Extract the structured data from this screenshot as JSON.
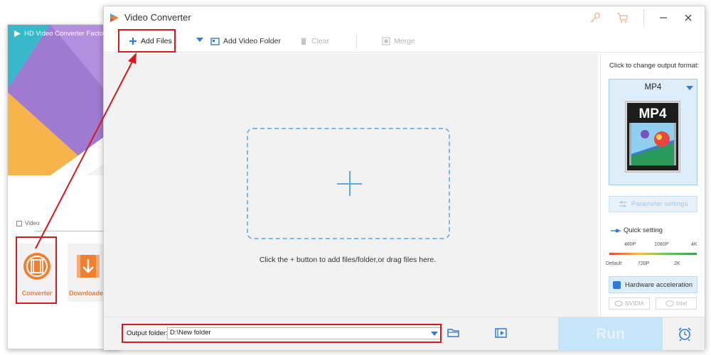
{
  "background_app": {
    "title": "HD Video Converter Factory",
    "section_label": "Video",
    "tiles": [
      {
        "label": "Converter",
        "icon": "film-icon"
      },
      {
        "label": "Downloader",
        "icon": "download-icon"
      }
    ]
  },
  "window": {
    "title": "Video Converter",
    "titlebar_icons": [
      "key-icon",
      "cart-icon",
      "minimize-icon",
      "close-icon"
    ]
  },
  "toolbar": {
    "add_files": "Add Files",
    "add_video_folder": "Add Video Folder",
    "clear": "Clear",
    "merge": "Merge"
  },
  "drop_area": {
    "hint": "Click the + button to add files/folder,or drag files here."
  },
  "side_panel": {
    "caption": "Click to change output format:",
    "format": "MP4",
    "format_thumb_text": "MP4",
    "parameter_settings": "Parameter settings",
    "quick_setting": "Quick setting",
    "quality_top": [
      "480P",
      "1080P",
      "4K"
    ],
    "quality_bottom": [
      "Default",
      "720P",
      "2K"
    ],
    "hardware_acceleration": "Hardware acceleration",
    "chips": [
      "NVIDIA",
      "Intel"
    ]
  },
  "bottombar": {
    "output_label": "Output folder:",
    "output_value": "D:\\New folder",
    "run": "Run"
  },
  "colors": {
    "accent_blue": "#2f7ad8",
    "annotation_red": "#d8181f",
    "run_button": "#c5e6fa",
    "launcher_orange": "#f08030"
  }
}
